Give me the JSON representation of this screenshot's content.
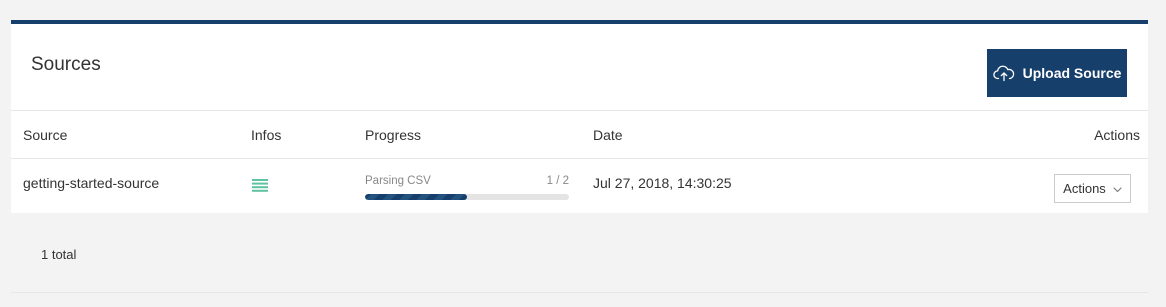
{
  "header": {
    "title": "Sources",
    "upload_button_label": "Upload Source",
    "upload_icon": "cloud-upload-icon"
  },
  "table": {
    "columns": [
      "Source",
      "Infos",
      "Progress",
      "Date",
      "Actions"
    ],
    "rows": [
      {
        "source": "getting-started-source",
        "info_icon": "list-icon",
        "progress_label": "Parsing CSV",
        "progress_count": "1 / 2",
        "progress_fraction": 0.5,
        "date": "Jul 27, 2018, 14:30:25",
        "actions_label": "Actions"
      }
    ]
  },
  "footer": {
    "total_text": "1 total"
  },
  "colors": {
    "brand": "#173f6b",
    "info_icon": "#5fc3a1",
    "background": "#f3f3f3"
  }
}
